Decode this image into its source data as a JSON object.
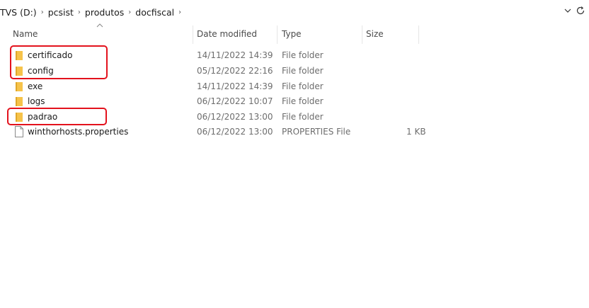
{
  "address_bar": {
    "breadcrumbs": [
      "TVS (D:)",
      "pcsist",
      "produtos",
      "docfiscal"
    ],
    "separator": "›",
    "dropdown_icon": "chevron-down-icon",
    "refresh_icon": "refresh-icon"
  },
  "columns": {
    "name": "Name",
    "date_modified": "Date modified",
    "type": "Type",
    "size": "Size"
  },
  "files": [
    {
      "name": "certificado",
      "date": "14/11/2022 14:39",
      "type": "File folder",
      "size": "",
      "icon": "folder-icon"
    },
    {
      "name": "config",
      "date": "05/12/2022 22:16",
      "type": "File folder",
      "size": "",
      "icon": "folder-icon"
    },
    {
      "name": "exe",
      "date": "14/11/2022 14:39",
      "type": "File folder",
      "size": "",
      "icon": "folder-icon"
    },
    {
      "name": "logs",
      "date": "06/12/2022 10:07",
      "type": "File folder",
      "size": "",
      "icon": "folder-icon"
    },
    {
      "name": "padrao",
      "date": "06/12/2022 13:00",
      "type": "File folder",
      "size": "",
      "icon": "folder-icon"
    },
    {
      "name": "winthorhosts.properties",
      "date": "06/12/2022 13:00",
      "type": "PROPERTIES File",
      "size": "1 KB",
      "icon": "file-icon"
    }
  ],
  "colors": {
    "folder": "#f6c34a",
    "highlight": "#e3121d"
  }
}
